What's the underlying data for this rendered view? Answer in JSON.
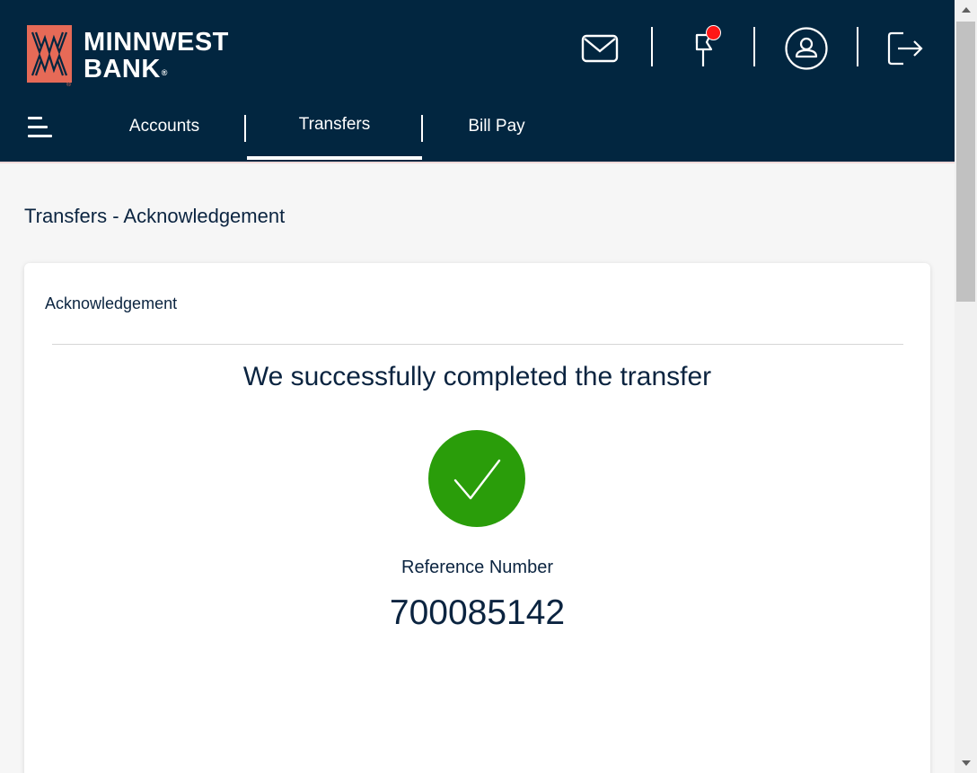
{
  "brand": {
    "line1": "MINNWEST",
    "line2": "BANK",
    "registered": "®",
    "colors": {
      "header_bg": "#022640",
      "logo_accent": "#e66a57"
    }
  },
  "header_icons": [
    {
      "name": "mail-icon"
    },
    {
      "name": "flag-icon",
      "has_notification": true,
      "notification_color": "#ff1616"
    },
    {
      "name": "user-profile-icon"
    },
    {
      "name": "logout-icon"
    }
  ],
  "nav": {
    "menu_icon": "hamburger-menu-icon",
    "tabs": [
      {
        "label": "Accounts",
        "active": false
      },
      {
        "label": "Transfers",
        "active": true
      },
      {
        "label": "Bill Pay",
        "active": false
      }
    ]
  },
  "page": {
    "title": "Transfers - Acknowledgement"
  },
  "card": {
    "title": "Acknowledgement",
    "success_message": "We successfully completed the transfer",
    "status_icon": "checkmark-icon",
    "success_color": "#2a9d0a",
    "reference_label": "Reference Number",
    "reference_number": "700085142"
  },
  "scrollbar": {
    "up_icon": "scroll-up-arrow-icon",
    "down_icon": "scroll-down-arrow-icon"
  }
}
